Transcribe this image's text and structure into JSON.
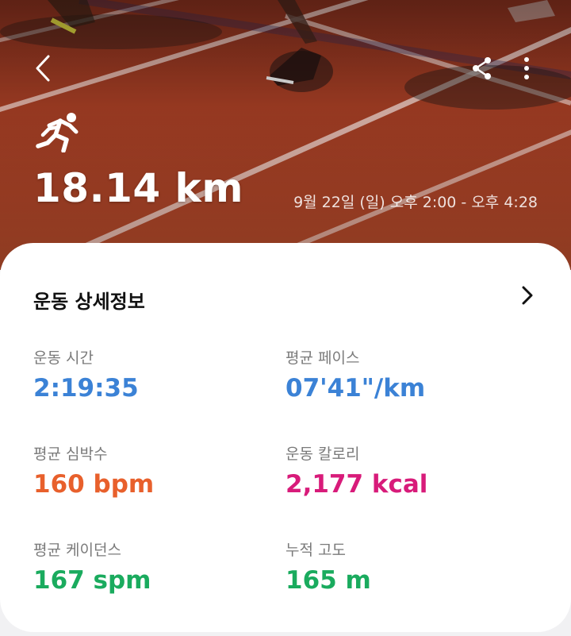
{
  "hero": {
    "distance": "18.14 km",
    "date_range": "9월 22일 (일) 오후 2:00 - 오후 4:28"
  },
  "card": {
    "title": "운동 상세정보",
    "metrics": [
      {
        "label": "운동 시간",
        "value": "2:19:35",
        "color": "#3b82d6"
      },
      {
        "label": "평균 페이스",
        "value": "07'41\"/km",
        "color": "#3b82d6"
      },
      {
        "label": "평균 심박수",
        "value": "160 bpm",
        "color": "#e8602c"
      },
      {
        "label": "운동 칼로리",
        "value": "2,177 kcal",
        "color": "#d81b7a"
      },
      {
        "label": "평균 케이던스",
        "value": "167 spm",
        "color": "#1aab5e"
      },
      {
        "label": "누적 고도",
        "value": "165 m",
        "color": "#1aab5e"
      }
    ]
  }
}
